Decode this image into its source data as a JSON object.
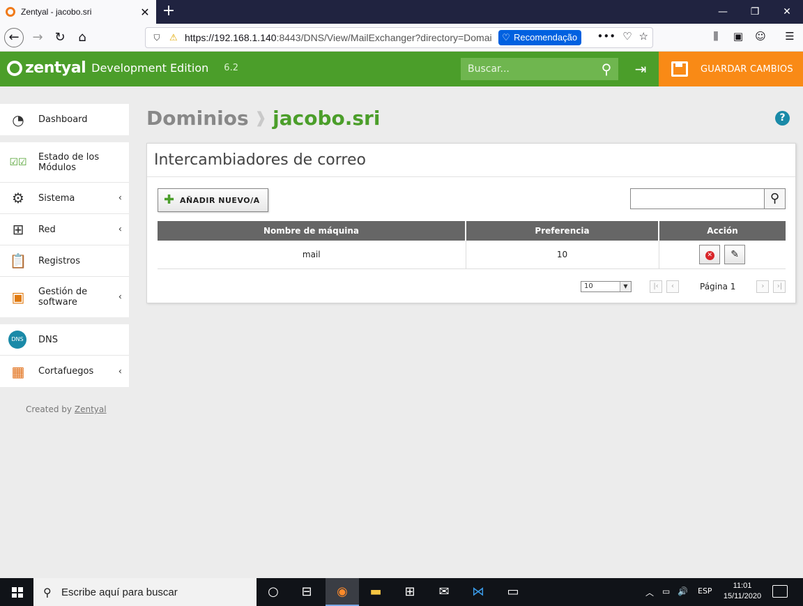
{
  "browser": {
    "tab_title": "Zentyal - jacobo.sri",
    "url_host": "https://192.168.1.140",
    "url_rest": ":8443/DNS/View/MailExchanger?directory=Domai",
    "recommendation": "Recomendação"
  },
  "header": {
    "logo": "zentyal",
    "edition": "Development Edition",
    "version": "6.2",
    "search_placeholder": "Buscar...",
    "save_label": "GUARDAR CAMBIOS"
  },
  "sidebar": {
    "groups": [
      [
        {
          "label": "Dashboard"
        }
      ],
      [
        {
          "label": "Estado de los Módulos"
        },
        {
          "label": "Sistema"
        },
        {
          "label": "Red"
        },
        {
          "label": "Registros"
        },
        {
          "label": "Gestión de software"
        }
      ],
      [
        {
          "label": "DNS"
        },
        {
          "label": "Cortafuegos"
        }
      ]
    ],
    "created_by": "Created by",
    "created_link": "Zentyal"
  },
  "breadcrumb": {
    "parent": "Dominios",
    "separator": "❱",
    "current": "jacobo.sri"
  },
  "panel": {
    "title": "Intercambiadores de correo",
    "add_button": "AÑADIR NUEVO/A",
    "columns": [
      "Nombre de máquina",
      "Preferencia",
      "Acción"
    ],
    "rows": [
      {
        "name": "mail",
        "preference": "10"
      }
    ],
    "page_size": "10",
    "page_label": "Página 1"
  },
  "taskbar": {
    "search_text": "Escribe aquí para buscar",
    "language": "ESP",
    "time": "11:01",
    "date": "15/11/2020"
  },
  "colors": {
    "header_green": "#4b9e2a",
    "save_orange": "#f98a16",
    "table_header": "#666666"
  }
}
